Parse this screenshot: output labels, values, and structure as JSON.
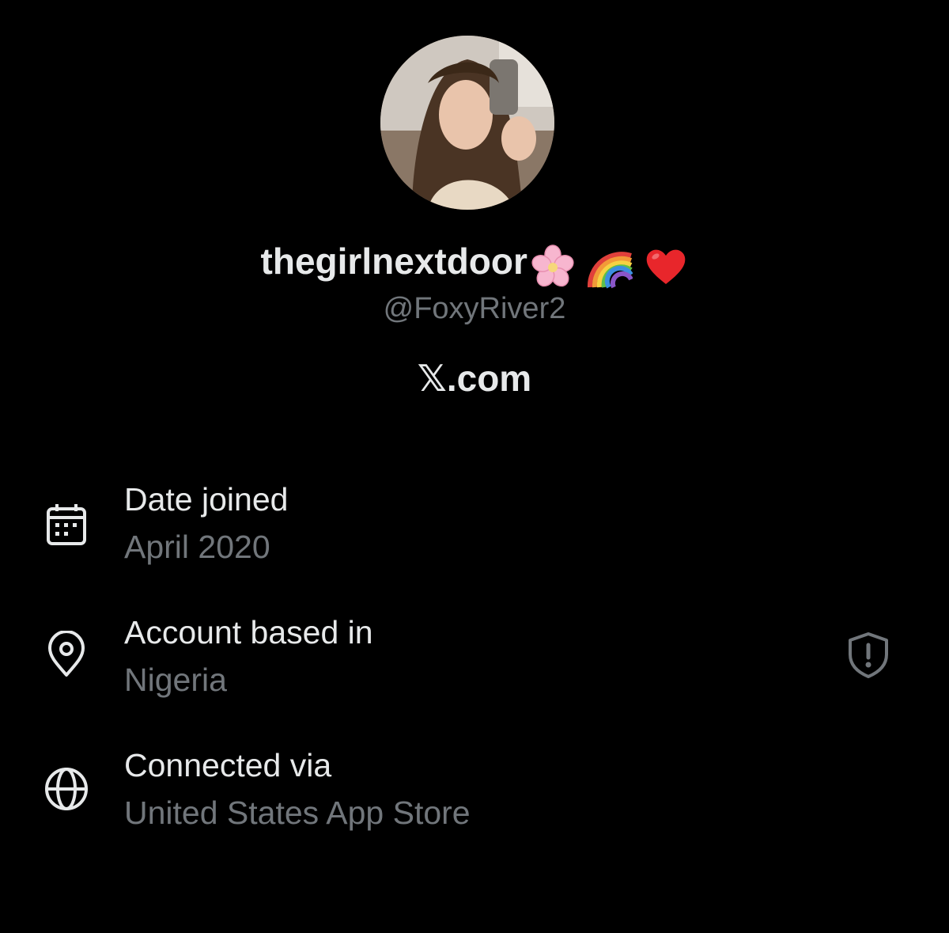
{
  "profile": {
    "display_name": "thegirlnextdoor",
    "display_name_emojis": [
      "cherry-blossom-emoji",
      "rainbow-emoji",
      "red-heart-emoji"
    ],
    "handle": "@FoxyRiver2",
    "site": "𝕏.com"
  },
  "about": {
    "rows": [
      {
        "icon": "calendar-icon",
        "label": "Date joined",
        "value": "April 2020"
      },
      {
        "icon": "location-pin-icon",
        "label": "Account based in",
        "value": "Nigeria",
        "trailing_icon": "shield-alert-icon"
      },
      {
        "icon": "globe-icon",
        "label": "Connected via",
        "value": "United States App Store"
      }
    ]
  },
  "colors": {
    "background": "#000000",
    "primary_text": "#e7e9ea",
    "secondary_text": "#71767b"
  }
}
